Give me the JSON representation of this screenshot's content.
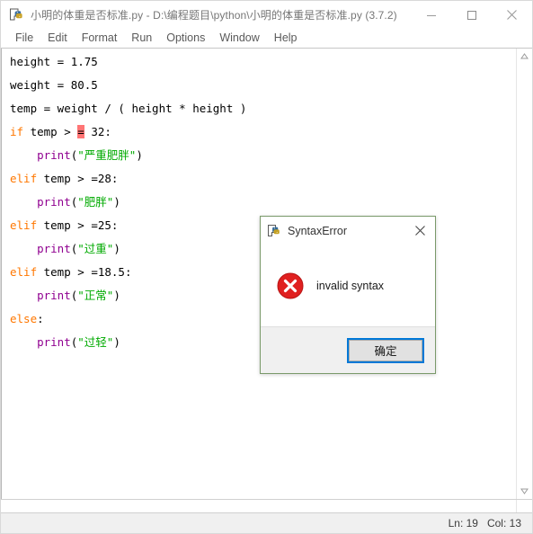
{
  "window": {
    "title": "小明的体重是否标准.py - D:\\编程题目\\python\\小明的体重是否标准.py (3.7.2)",
    "icon": "python-idle-icon",
    "controls": {
      "minimize": "minimize-icon",
      "maximize": "maximize-icon",
      "close": "close-icon"
    }
  },
  "menubar": {
    "items": [
      {
        "label": "File"
      },
      {
        "label": "Edit"
      },
      {
        "label": "Format"
      },
      {
        "label": "Run"
      },
      {
        "label": "Options"
      },
      {
        "label": "Window"
      },
      {
        "label": "Help"
      }
    ]
  },
  "editor": {
    "lines": [
      {
        "n": 1,
        "tokens": [
          {
            "t": "height = 1.75",
            "c": "plain"
          }
        ]
      },
      {
        "n": 2,
        "tokens": [
          {
            "t": "weight = 80.5",
            "c": "plain"
          }
        ]
      },
      {
        "n": 3,
        "tokens": [
          {
            "t": "temp = weight / ( height * height )",
            "c": "plain"
          }
        ]
      },
      {
        "n": 4,
        "tokens": [
          {
            "t": "if",
            "c": "kw"
          },
          {
            "t": " temp > ",
            "c": "plain"
          },
          {
            "t": "=",
            "c": "errhl"
          },
          {
            "t": " 32:",
            "c": "plain"
          }
        ]
      },
      {
        "n": 5,
        "tokens": [
          {
            "t": "    ",
            "c": "plain"
          },
          {
            "t": "print",
            "c": "bif"
          },
          {
            "t": "(",
            "c": "plain"
          },
          {
            "t": "\"严重肥胖\"",
            "c": "str"
          },
          {
            "t": ")",
            "c": "plain"
          }
        ]
      },
      {
        "n": 6,
        "tokens": [
          {
            "t": "elif",
            "c": "kw"
          },
          {
            "t": " temp > =28:",
            "c": "plain"
          }
        ]
      },
      {
        "n": 7,
        "tokens": [
          {
            "t": "    ",
            "c": "plain"
          },
          {
            "t": "print",
            "c": "bif"
          },
          {
            "t": "(",
            "c": "plain"
          },
          {
            "t": "\"肥胖\"",
            "c": "str"
          },
          {
            "t": ")",
            "c": "plain"
          }
        ]
      },
      {
        "n": 8,
        "tokens": [
          {
            "t": "elif",
            "c": "kw"
          },
          {
            "t": " temp > =25:",
            "c": "plain"
          }
        ]
      },
      {
        "n": 9,
        "tokens": [
          {
            "t": "    ",
            "c": "plain"
          },
          {
            "t": "print",
            "c": "bif"
          },
          {
            "t": "(",
            "c": "plain"
          },
          {
            "t": "\"过重\"",
            "c": "str"
          },
          {
            "t": ")",
            "c": "plain"
          }
        ]
      },
      {
        "n": 10,
        "tokens": [
          {
            "t": "elif",
            "c": "kw"
          },
          {
            "t": " temp > =18.5:",
            "c": "plain"
          }
        ]
      },
      {
        "n": 11,
        "tokens": [
          {
            "t": "    ",
            "c": "plain"
          },
          {
            "t": "print",
            "c": "bif"
          },
          {
            "t": "(",
            "c": "plain"
          },
          {
            "t": "\"正常\"",
            "c": "str"
          },
          {
            "t": ")",
            "c": "plain"
          }
        ]
      },
      {
        "n": 12,
        "tokens": [
          {
            "t": "else",
            "c": "kw"
          },
          {
            "t": ":",
            "c": "plain"
          }
        ]
      },
      {
        "n": 13,
        "tokens": [
          {
            "t": "    ",
            "c": "plain"
          },
          {
            "t": "print",
            "c": "bif"
          },
          {
            "t": "(",
            "c": "plain"
          },
          {
            "t": "\"过轻\"",
            "c": "str"
          },
          {
            "t": ")",
            "c": "plain"
          }
        ]
      }
    ],
    "colors": {
      "keyword": "#ff7700",
      "builtin": "#900090",
      "string": "#00aa00",
      "error_highlight": "#ff7575",
      "text": "#000000"
    }
  },
  "scrollbars": {
    "vertical_up": "scroll-up-arrow-icon",
    "vertical_down": "scroll-down-arrow-icon"
  },
  "statusbar": {
    "line_label": "Ln: 19",
    "col_label": "Col: 13"
  },
  "dialog": {
    "title": "SyntaxError",
    "icon": "python-icon",
    "close_icon": "close-icon",
    "error_icon": "error-circle-icon",
    "message": "invalid syntax",
    "ok_label": "确定",
    "accent_color": "#0078d7",
    "error_color": "#e81123"
  }
}
